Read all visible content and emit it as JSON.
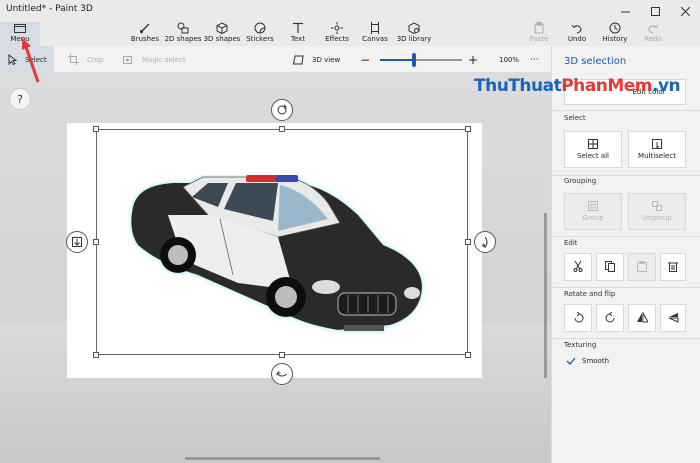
{
  "window": {
    "title": "Untitled* - Paint 3D"
  },
  "ribbon": {
    "menu": "Menu",
    "tools": [
      "Brushes",
      "2D shapes",
      "3D shapes",
      "Stickers",
      "Text",
      "Effects",
      "Canvas",
      "3D library"
    ],
    "paste": "Paste",
    "undo": "Undo",
    "history": "History",
    "redo": "Redo"
  },
  "toolbar": {
    "select": "Select",
    "crop": "Crop",
    "magic_select": "Magic select",
    "view_3d": "3D view",
    "zoom": "100%",
    "zoom_fraction": 0.42,
    "more": "···"
  },
  "canvas": {
    "help": "?"
  },
  "watermark": {
    "part1": "ThuThuat",
    "part2": "PhanMem",
    "part3": ".vn"
  },
  "panel": {
    "title": "3D selection",
    "edit_color": "Edit color",
    "select_heading": "Select",
    "select_all": "Select all",
    "multiselect": "Multiselect",
    "grouping_heading": "Grouping",
    "group": "Group",
    "ungroup": "Ungroup",
    "edit_heading": "Edit",
    "rotate_heading": "Rotate and flip",
    "texturing_heading": "Texturing",
    "smooth": "Smooth"
  },
  "colors": {
    "accent": "#1a5aa8",
    "selected_bg": "#d7dde6"
  }
}
